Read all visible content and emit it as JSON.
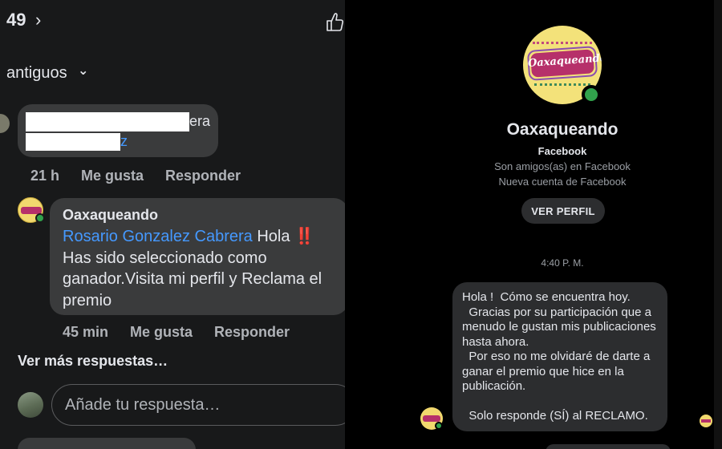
{
  "left_panel": {
    "reaction_count": "49",
    "sort_label": "antiguos",
    "first_comment": {
      "text_tail_line1": "era",
      "text_tail_line2": "z",
      "time": "21 h",
      "like_label": "Me gusta",
      "reply_label": "Responder"
    },
    "second_comment": {
      "author": "Oaxaqueando",
      "mention": "Rosario Gonzalez Cabrera",
      "greeting": "Hola",
      "emoji": "‼️",
      "body": "Has sido seleccionado como ganador.Visita mi perfil y Reclama el premio",
      "time": "45 min",
      "like_label": "Me gusta",
      "reply_label": "Responder"
    },
    "more_replies": "Ver más respuestas…",
    "reply_placeholder": "Añade tu respuesta…"
  },
  "right_panel": {
    "profile_logo_text": "Oaxaqueando",
    "name": "Oaxaqueando",
    "platform": "Facebook",
    "friends_status": "Son amigos(as) en Facebook",
    "account_note": "Nueva cuenta de Facebook",
    "view_profile_label": "VER PERFIL",
    "timestamp": "4:40 P. M.",
    "message": "Hola !  Cómo se encuentra hoy.\n  Gracias por su participación que a menudo le gustan mis publicaciones hasta ahora.\n  Por eso no me olvidaré de darte a ganar el premio que hice en la publicación.\n\n  Solo responde (SÍ) al RECLAMO."
  },
  "colors": {
    "panel_bg": "#18191a",
    "bubble_bg": "#3a3b3c",
    "link_blue": "#4599ff",
    "online_green": "#31a24c",
    "alert_red": "#f02849"
  },
  "icons": [
    "chevron-right-icon",
    "thumbs-up-icon",
    "chevron-down-icon",
    "online-status-icon"
  ]
}
